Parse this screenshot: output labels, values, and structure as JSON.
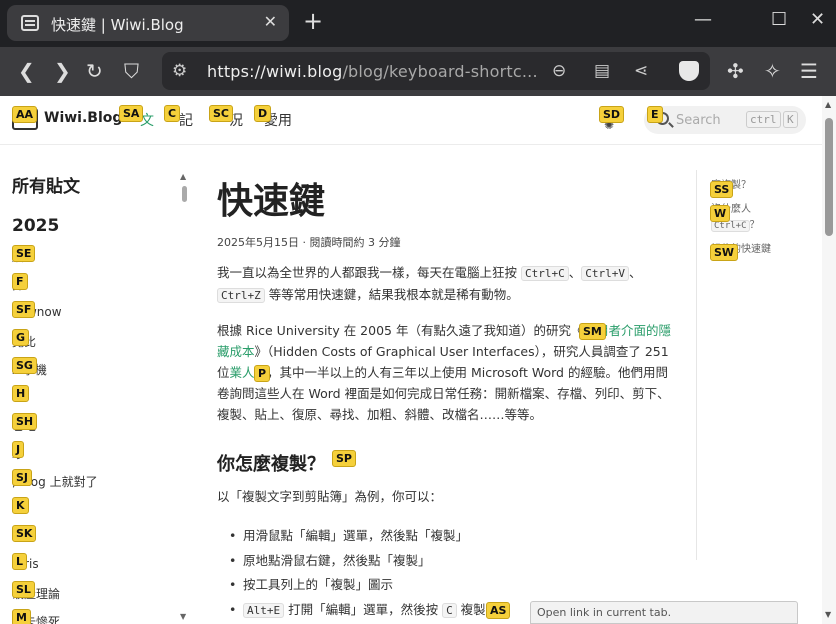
{
  "browser": {
    "tab_title": "快速鍵 | Wiwi.Blog",
    "tab_close": "✕",
    "new_tab": "+",
    "window_controls": {
      "minimize": "—",
      "maximize": "☐",
      "close": "✕"
    },
    "url_host": "https://wiwi.blog",
    "url_path": "/blog/keyboard-shortc...",
    "status_text": "Open link in current tab."
  },
  "site": {
    "brand": "Wiwi.Blog",
    "nav": [
      {
        "label": "文",
        "hint": "SA",
        "active": true
      },
      {
        "label": "記",
        "hint": "C",
        "active": false
      },
      {
        "label": "況",
        "hint": "SC",
        "active": false
      },
      {
        "label": "愛用",
        "hint": "D",
        "active": false
      }
    ],
    "logo_hint": "AA",
    "theme_hint": "SD",
    "search_hint": "E",
    "search_placeholder": "Search",
    "search_kbd_1": "ctrl",
    "search_kbd_2": "K"
  },
  "sidebar": {
    "title": "所有貼文",
    "year": "2025",
    "items": [
      {
        "hint": "SE",
        "text": "膜"
      },
      {
        "hint": "F",
        "text": "抹"
      },
      {
        "hint": "SF",
        "text": "nownow"
      },
      {
        "hint": "G",
        "text": "寬比"
      },
      {
        "hint": "SG",
        "text": "x 掌機"
      },
      {
        "hint": "H",
        "text": ""
      },
      {
        "hint": "SH",
        "text": "它吧"
      },
      {
        "hint": "J",
        "text": "珍"
      },
      {
        "hint": "SJ",
        "text": "; blog 上就對了"
      },
      {
        "hint": "K",
        "text": "w"
      },
      {
        "hint": "SK",
        "text": "0-8"
      },
      {
        "hint": "L",
        "text": "otris"
      },
      {
        "hint": "SL",
        "text": "破產理論"
      },
      {
        "hint": "M",
        "text": "刮卡慘死"
      }
    ]
  },
  "article": {
    "title": "快速鍵",
    "meta": "2025年5月15日 · 閱讀時間約 3 分鐘",
    "p1": {
      "before": "我一直以為全世界的人都跟我一樣，每天在電腦上狂按 ",
      "k1": "Ctrl+C",
      "sep1": "、",
      "k2": "Ctrl+V",
      "sep2": "、",
      "k3": "Ctrl+Z",
      "after": " 等等常用快速鍵，結果我根本就是稀有動物。"
    },
    "p2": {
      "a": "根據 Rice University 在 2005 年（有點久遠了我知道）的研究《",
      "link1_hint": "SM",
      "link1": "使用者介面的隱藏成本",
      "b": "》（Hidden Costs of Graphical User Interfaces），研究人員調查了 251 位",
      "link2_hint": "P",
      "link2": "業人士",
      "c": "，其中一半以上的人有三年以上使用 Microsoft Word 的經驗。他們用問卷詢問這些人在 Word 裡面是如何完成日常任務：開新檔案、存檔、列印、剪下、複製、貼上、復原、尋找、加粗、斜體、改檔名……等等。"
    },
    "h2": "你怎麼複製？",
    "h2_hint": "SP",
    "p3": "以「複製文字到剪貼簿」為例，你可以：",
    "steps": [
      "用滑鼠點「編輯」選單，然後點「複製」",
      "原地點滑鼠右鍵，然後點「複製」",
      "按工具列上的「複製」圖示"
    ],
    "step4": {
      "kbd1": "Alt+E",
      "mid": " 打開「編輯」選單，然後按 ",
      "kbd2": "C",
      "end": " 複製",
      "hint": "AS"
    }
  },
  "toc": {
    "items": [
      {
        "hint": "SS",
        "text": "麼複製？"
      },
      {
        "hint": "W",
        "text": "沒什麼人",
        "kbd": "Ctrl+C",
        "tail": "？"
      },
      {
        "hint": "SW",
        "text": "記住的快速鍵"
      }
    ]
  }
}
